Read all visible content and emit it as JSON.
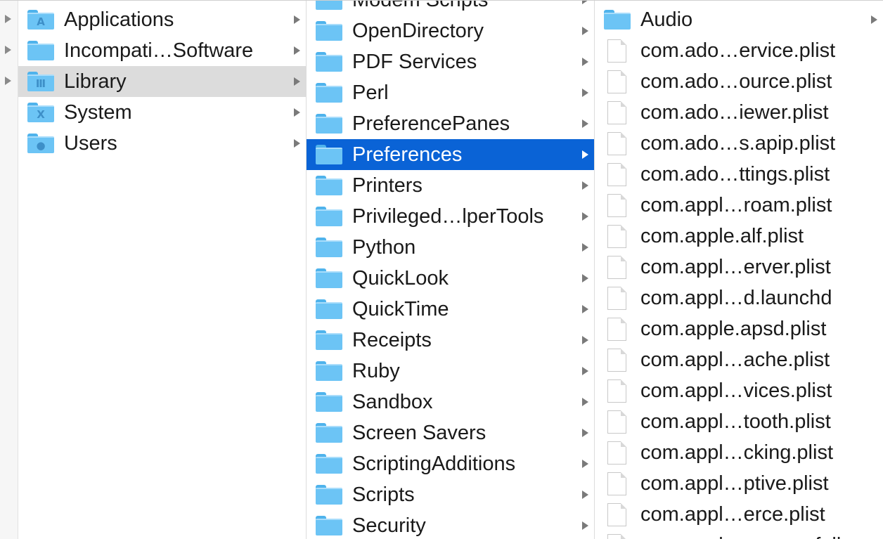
{
  "column1": {
    "items": [
      {
        "label": "Applications",
        "icon": "applications-folder-icon",
        "glyph": "A",
        "selected": false
      },
      {
        "label": "Incompati…Software",
        "icon": "folder-icon",
        "glyph": "",
        "selected": false
      },
      {
        "label": "Library",
        "icon": "library-folder-icon",
        "glyph": "Ⅲ",
        "selected": true
      },
      {
        "label": "System",
        "icon": "system-folder-icon",
        "glyph": "X",
        "selected": false
      },
      {
        "label": "Users",
        "icon": "users-folder-icon",
        "glyph": "●",
        "selected": false
      }
    ]
  },
  "column2": {
    "items": [
      {
        "label": "Modem Scripts"
      },
      {
        "label": "OpenDirectory"
      },
      {
        "label": "PDF Services"
      },
      {
        "label": "Perl"
      },
      {
        "label": "PreferencePanes"
      },
      {
        "label": "Preferences",
        "selected": true
      },
      {
        "label": "Printers"
      },
      {
        "label": "Privileged…lperTools"
      },
      {
        "label": "Python"
      },
      {
        "label": "QuickLook"
      },
      {
        "label": "QuickTime"
      },
      {
        "label": "Receipts"
      },
      {
        "label": "Ruby"
      },
      {
        "label": "Sandbox"
      },
      {
        "label": "Screen Savers"
      },
      {
        "label": "ScriptingAdditions"
      },
      {
        "label": "Scripts"
      },
      {
        "label": "Security"
      }
    ]
  },
  "column3": {
    "items": [
      {
        "label": "Audio",
        "kind": "folder"
      },
      {
        "label": "com.ado…ervice.plist",
        "kind": "file"
      },
      {
        "label": "com.ado…ource.plist",
        "kind": "file"
      },
      {
        "label": "com.ado…iewer.plist",
        "kind": "file"
      },
      {
        "label": "com.ado…s.apip.plist",
        "kind": "file"
      },
      {
        "label": "com.ado…ttings.plist",
        "kind": "file"
      },
      {
        "label": "com.appl…roam.plist",
        "kind": "file"
      },
      {
        "label": "com.apple.alf.plist",
        "kind": "file"
      },
      {
        "label": "com.appl…erver.plist",
        "kind": "file"
      },
      {
        "label": "com.appl…d.launchd",
        "kind": "file"
      },
      {
        "label": "com.apple.apsd.plist",
        "kind": "file"
      },
      {
        "label": "com.appl…ache.plist",
        "kind": "file"
      },
      {
        "label": "com.appl…vices.plist",
        "kind": "file"
      },
      {
        "label": "com.appl…tooth.plist",
        "kind": "file"
      },
      {
        "label": "com.appl…cking.plist",
        "kind": "file"
      },
      {
        "label": "com.appl…ptive.plist",
        "kind": "file"
      },
      {
        "label": "com.appl…erce.plist",
        "kind": "file"
      },
      {
        "label": "com.appl…oreco…full",
        "kind": "file"
      }
    ]
  },
  "colors": {
    "selection_blue": "#0a63d6",
    "selection_gray": "#dcdcdc",
    "folder_blue": "#6cc4f5"
  }
}
